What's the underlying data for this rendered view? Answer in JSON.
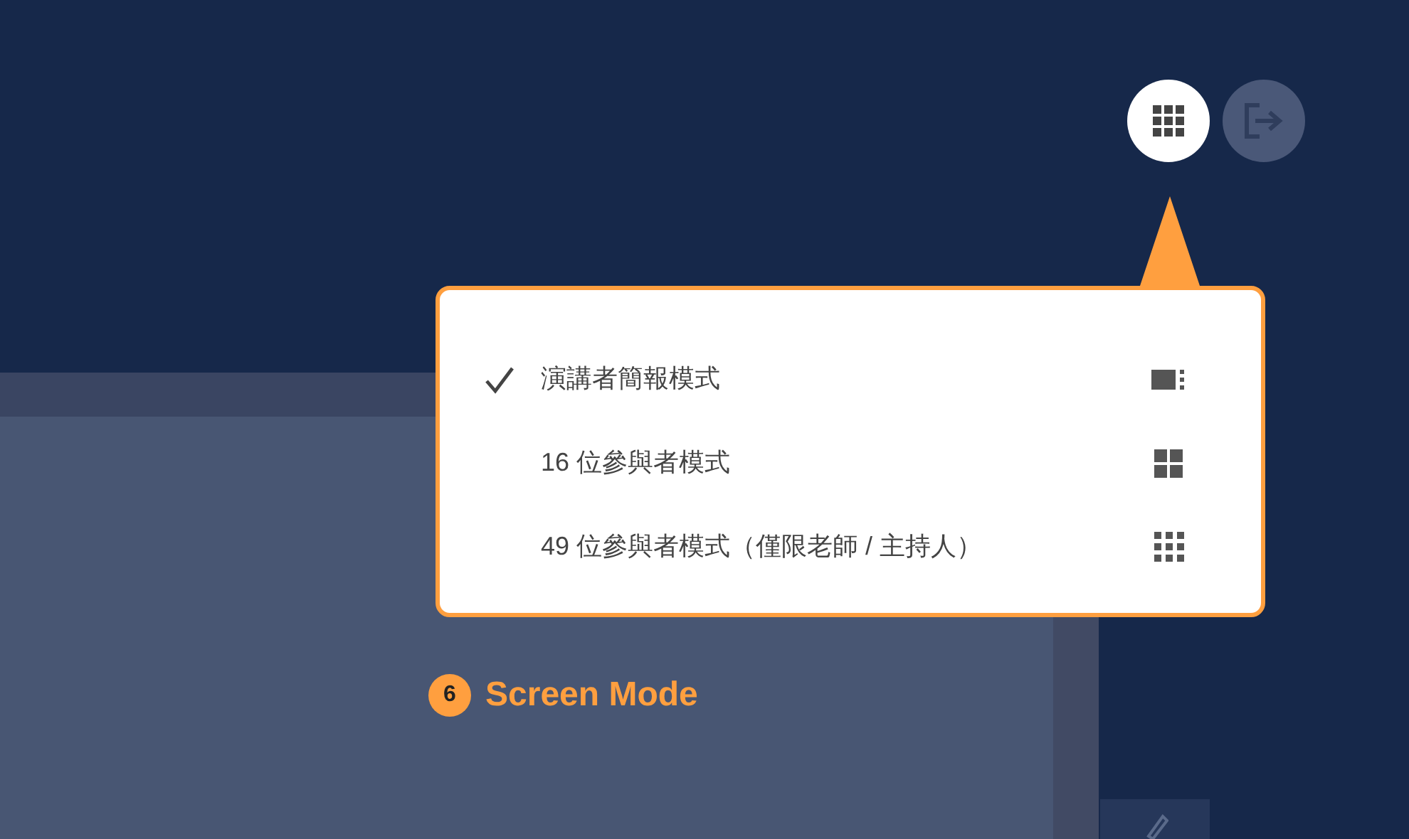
{
  "toolbar": {
    "buttons": [
      {
        "kind": "grid",
        "selected": true
      },
      {
        "kind": "exit",
        "selected": false
      }
    ]
  },
  "menu": {
    "items": [
      {
        "label": "演講者簡報模式",
        "checked": true,
        "kind": "presenter"
      },
      {
        "label": "16 位參與者模式",
        "checked": false,
        "kind": "grid16"
      },
      {
        "label": "49 位參與者模式（僅限老師 / 主持人）",
        "checked": false,
        "kind": "grid49"
      }
    ]
  },
  "callout": {
    "number": "6",
    "label": "Screen Mode"
  }
}
